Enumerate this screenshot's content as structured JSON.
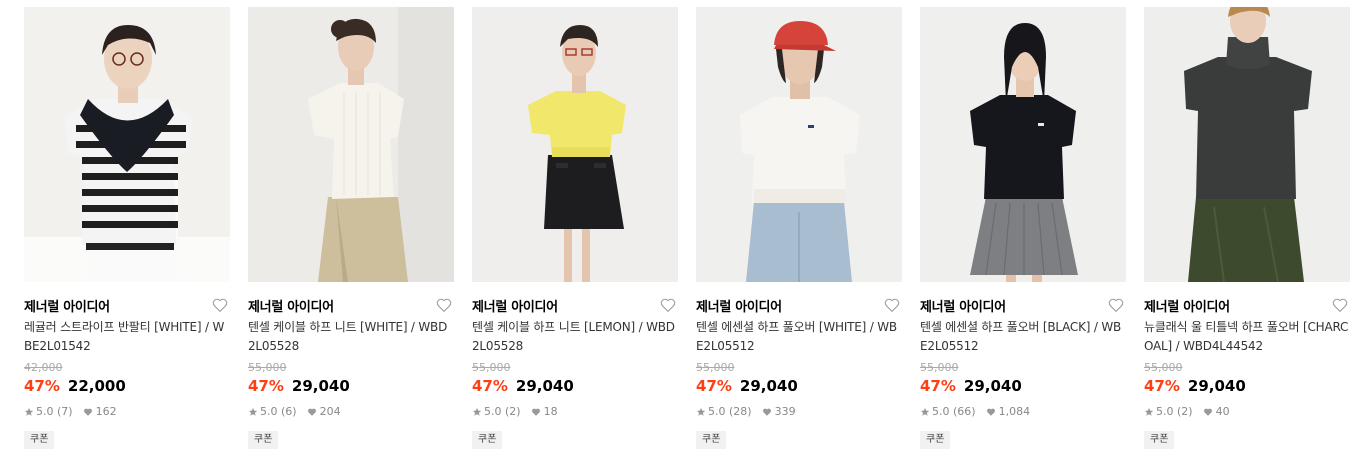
{
  "products": [
    {
      "brand": "제너럴 아이디어",
      "name": "레귤러 스트라이프 반팔티 [WHITE] / WBE2L01542",
      "original_price": "42,000",
      "discount": "47%",
      "price": "22,000",
      "rating": "5.0",
      "reviews": "(7)",
      "likes": "162",
      "badge": "쿠폰"
    },
    {
      "brand": "제너럴 아이디어",
      "name": "텐셀 케이블 하프 니트 [WHITE] / WBD2L05528",
      "original_price": "55,000",
      "discount": "47%",
      "price": "29,040",
      "rating": "5.0",
      "reviews": "(6)",
      "likes": "204",
      "badge": "쿠폰"
    },
    {
      "brand": "제너럴 아이디어",
      "name": "텐셀 케이블 하프 니트 [LEMON] / WBD2L05528",
      "original_price": "55,000",
      "discount": "47%",
      "price": "29,040",
      "rating": "5.0",
      "reviews": "(2)",
      "likes": "18",
      "badge": "쿠폰"
    },
    {
      "brand": "제너럴 아이디어",
      "name": "텐셀 에센셜 하프 풀오버 [WHITE] / WBE2L05512",
      "original_price": "55,000",
      "discount": "47%",
      "price": "29,040",
      "rating": "5.0",
      "reviews": "(28)",
      "likes": "339",
      "badge": "쿠폰"
    },
    {
      "brand": "제너럴 아이디어",
      "name": "텐셀 에센셜 하프 풀오버 [BLACK] / WBE2L05512",
      "original_price": "55,000",
      "discount": "47%",
      "price": "29,040",
      "rating": "5.0",
      "reviews": "(66)",
      "likes": "1,084",
      "badge": "쿠폰"
    },
    {
      "brand": "제너럴 아이디어",
      "name": "뉴클래식 울 티틀넥 하프 풀오버 [CHARCOAL] / WBD4L44542",
      "original_price": "55,000",
      "discount": "47%",
      "price": "29,040",
      "rating": "5.0",
      "reviews": "(2)",
      "likes": "40",
      "badge": "쿠폰"
    }
  ],
  "colors": {
    "discount": "#ff3e12",
    "muted": "#888888",
    "strike": "#aaaaaa",
    "coupon_bg": "#f1f1f1"
  },
  "icons": {
    "wishlist": "heart-outline-icon",
    "rating": "star-icon",
    "likes": "heart-filled-icon"
  }
}
